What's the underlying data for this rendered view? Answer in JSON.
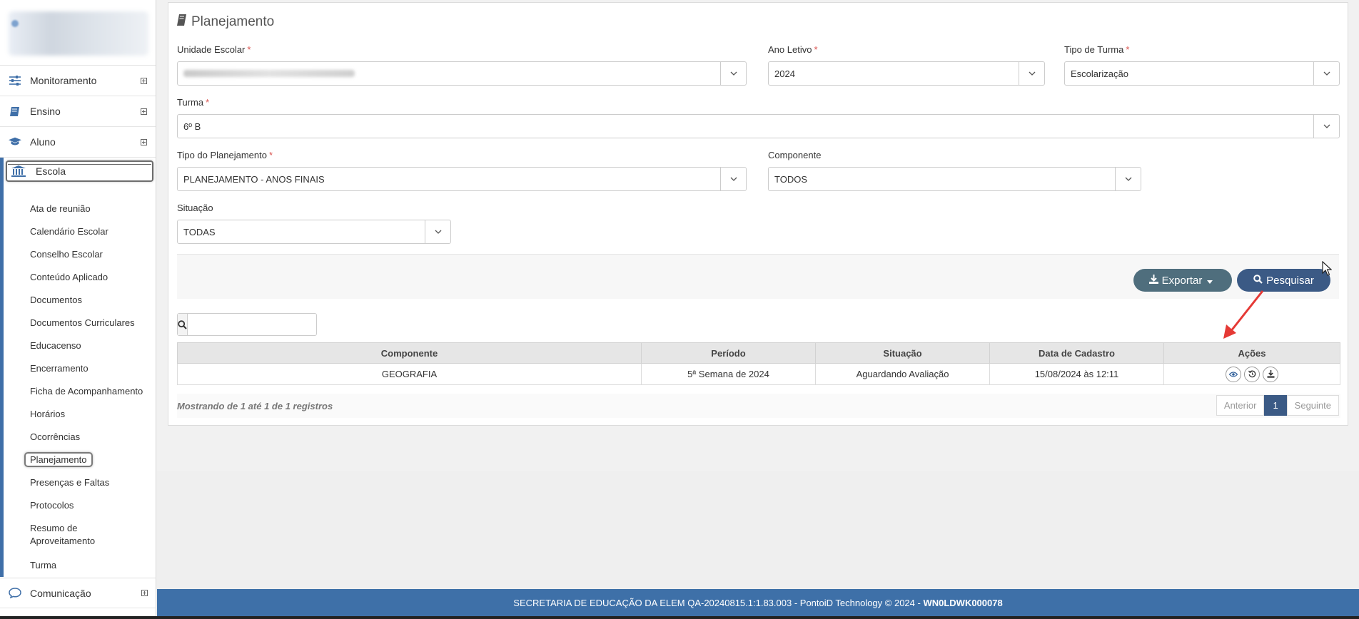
{
  "sidebar": {
    "items": [
      {
        "label": "Monitoramento",
        "icon": "sliders-icon"
      },
      {
        "label": "Ensino",
        "icon": "book-icon"
      },
      {
        "label": "Aluno",
        "icon": "graduation-cap-icon"
      },
      {
        "label": "Escola",
        "icon": "institution-icon"
      }
    ],
    "escola_submenu": [
      "Ata de reunião",
      "Calendário Escolar",
      "Conselho Escolar",
      "Conteúdo Aplicado",
      "Documentos",
      "Documentos Curriculares",
      "Educacenso",
      "Encerramento",
      "Ficha de Acompanhamento",
      "Horários",
      "Ocorrências",
      "Planejamento",
      "Presenças e Faltas",
      "Protocolos",
      "Resumo de Aproveitamento",
      "Turma"
    ],
    "comunicacao": "Comunicação"
  },
  "panel": {
    "title": "Planejamento",
    "fields": {
      "unidade_label": "Unidade Escolar",
      "ano_label": "Ano Letivo",
      "ano_value": "2024",
      "tipo_turma_label": "Tipo de Turma",
      "tipo_turma_value": "Escolarização",
      "turma_label": "Turma",
      "turma_value": "6º B",
      "tipo_plan_label": "Tipo do Planejamento",
      "tipo_plan_value": "PLANEJAMENTO - ANOS FINAIS",
      "componente_label": "Componente",
      "componente_value": "TODOS",
      "situacao_label": "Situação",
      "situacao_value": "TODAS",
      "required_mark": "*"
    },
    "buttons": {
      "export": "Exportar",
      "search": "Pesquisar"
    },
    "table": {
      "headers": [
        "Componente",
        "Período",
        "Situação",
        "Data de Cadastro",
        "Ações"
      ],
      "rows": [
        [
          "GEOGRAFIA",
          "5ª Semana de 2024",
          "Aguardando Avaliação",
          "15/08/2024 às 12:11"
        ]
      ]
    },
    "showing": "Mostrando de 1 até 1 de 1 registros",
    "pager": {
      "prev": "Anterior",
      "current": "1",
      "next": "Seguinte"
    }
  },
  "footer": {
    "text": "SECRETARIA DE EDUCAÇÃO DA ELEM QA-20240815.1:1.83.003 - PontoiD Technology © 2024 - ",
    "code": "WN0LDWK000078"
  },
  "colors": {
    "primary": "#3e70a8",
    "button_search": "#3b5a85",
    "button_export": "#4f6e7d",
    "required": "#d9534f"
  }
}
